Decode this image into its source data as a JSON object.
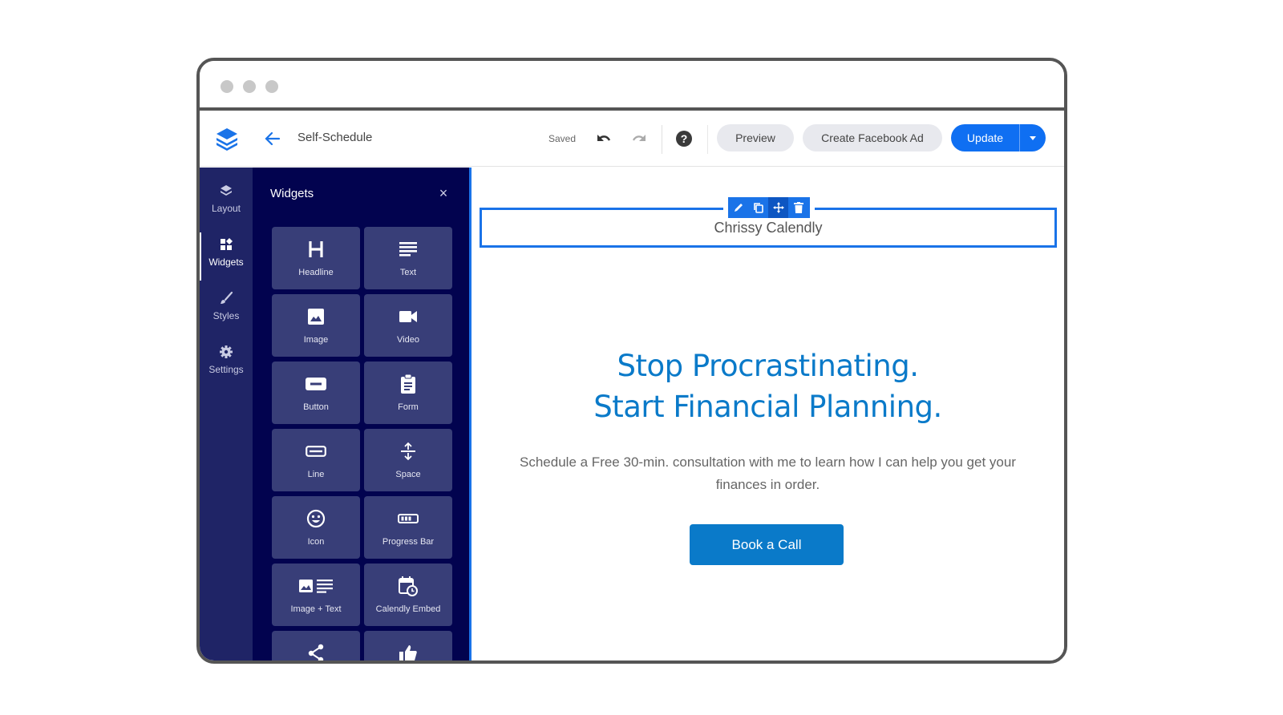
{
  "browser": {
    "traffic_lights": [
      "close",
      "minimize",
      "maximize"
    ]
  },
  "header": {
    "logo_icon": "layers-logo-icon",
    "back_icon": "arrow-left-icon",
    "page_name": "Self-Schedule",
    "status": "Saved",
    "undo_icon": "undo-icon",
    "redo_icon": "redo-icon",
    "help_icon": "?",
    "preview_label": "Preview",
    "facebook_ad_label": "Create Facebook Ad",
    "update_label": "Update",
    "accent": "#0f6ff2"
  },
  "rail": {
    "items": [
      {
        "label": "Layout",
        "icon": "layers-icon",
        "active": false
      },
      {
        "label": "Widgets",
        "icon": "widgets-icon",
        "active": true
      },
      {
        "label": "Styles",
        "icon": "brush-icon",
        "active": false
      },
      {
        "label": "Settings",
        "icon": "gear-icon",
        "active": false
      }
    ]
  },
  "panel": {
    "title": "Widgets",
    "close_icon": "×",
    "widgets": [
      {
        "label": "Headline",
        "icon": "headline-icon"
      },
      {
        "label": "Text",
        "icon": "text-lines-icon"
      },
      {
        "label": "Image",
        "icon": "image-icon"
      },
      {
        "label": "Video",
        "icon": "video-camera-icon"
      },
      {
        "label": "Button",
        "icon": "button-icon"
      },
      {
        "label": "Form",
        "icon": "clipboard-icon"
      },
      {
        "label": "Line",
        "icon": "line-icon"
      },
      {
        "label": "Space",
        "icon": "vertical-space-icon"
      },
      {
        "label": "Icon",
        "icon": "smiley-icon"
      },
      {
        "label": "Progress Bar",
        "icon": "progress-bar-icon"
      },
      {
        "label": "Image + Text",
        "icon": "image-text-icon"
      },
      {
        "label": "Calendly Embed",
        "icon": "calendar-clock-icon"
      },
      {
        "label": "",
        "icon": "share-icon"
      },
      {
        "label": "",
        "icon": "thumbs-up-icon"
      }
    ]
  },
  "canvas": {
    "selected_element": {
      "text": "Chrissy Calendly",
      "toolbar": [
        "edit-icon",
        "duplicate-icon",
        "move-icon",
        "delete-icon"
      ]
    },
    "hero": {
      "title_line1": "Stop Procrastinating.",
      "title_line2": "Start Financial Planning.",
      "subtitle": "Schedule a Free 30-min. consultation with me to learn how I can help you get your finances in order.",
      "cta_label": "Book a Call",
      "brand_color": "#0a7ac9"
    }
  }
}
